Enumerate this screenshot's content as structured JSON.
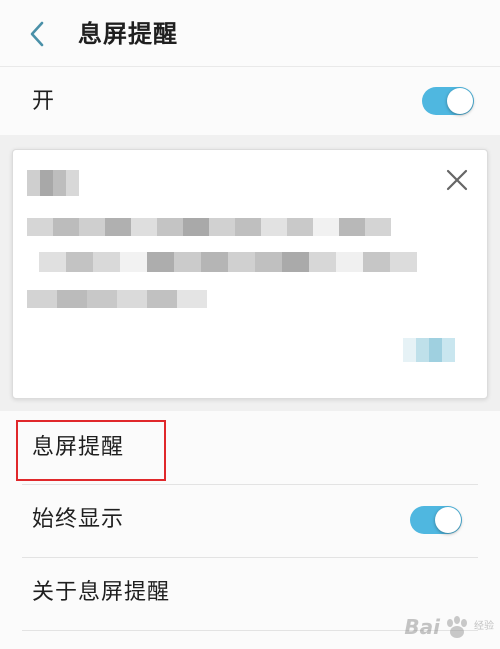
{
  "header": {
    "title": "息屏提醒",
    "back_icon": "chevron-left-icon"
  },
  "master": {
    "label": "开",
    "toggle_on": true
  },
  "preview": {
    "close_icon": "close-icon"
  },
  "list": {
    "items": [
      {
        "label": "息屏提醒",
        "has_toggle": false
      },
      {
        "label": "始终显示",
        "has_toggle": true,
        "toggle_on": true
      },
      {
        "label": "关于息屏提醒",
        "has_toggle": false
      }
    ]
  },
  "watermark": {
    "brand": "Bai",
    "sub": "经验"
  },
  "colors": {
    "accent": "#4fb7e0",
    "highlight": "#e0282b",
    "back_icon": "#4a90a8"
  }
}
